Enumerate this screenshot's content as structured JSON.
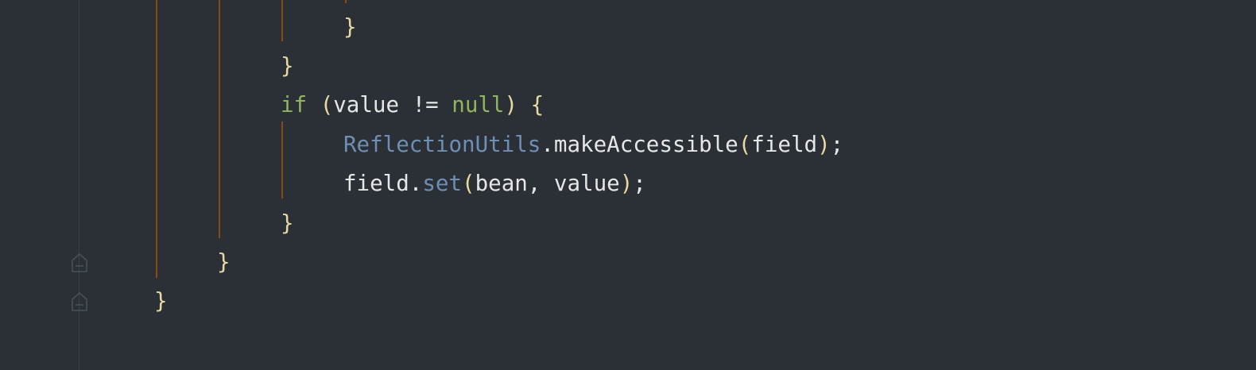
{
  "editor": {
    "colors": {
      "background": "#2a3035",
      "keyword": "#8fb55e",
      "bracket": "#e8d9a0",
      "type": "#6e8fb3",
      "text": "#e6e6e6",
      "indent_guide": "#8a4a18"
    },
    "gutter": {
      "icons": [
        "fold-end-icon",
        "fold-end-icon"
      ]
    },
    "lines": [
      {
        "name": "code-line-close-brace-1",
        "tokens": [
          {
            "text": "}",
            "kind": "brace"
          }
        ]
      },
      {
        "name": "code-line-close-brace-2",
        "tokens": [
          {
            "text": "}",
            "kind": "brace"
          }
        ]
      },
      {
        "name": "code-line-if",
        "tokens": [
          {
            "text": "if",
            "kind": "kw"
          },
          {
            "text": " ",
            "kind": "punct"
          },
          {
            "text": "(",
            "kind": "paren"
          },
          {
            "text": "value != ",
            "kind": "ident"
          },
          {
            "text": "null",
            "kind": "kw"
          },
          {
            "text": ")",
            "kind": "paren"
          },
          {
            "text": " ",
            "kind": "punct"
          },
          {
            "text": "{",
            "kind": "brace"
          }
        ]
      },
      {
        "name": "code-line-make-accessible",
        "tokens": [
          {
            "text": "ReflectionUtils",
            "kind": "cls"
          },
          {
            "text": ".makeAccessible",
            "kind": "ident"
          },
          {
            "text": "(",
            "kind": "paren"
          },
          {
            "text": "field",
            "kind": "ident"
          },
          {
            "text": ")",
            "kind": "paren"
          },
          {
            "text": ";",
            "kind": "punct"
          }
        ]
      },
      {
        "name": "code-line-field-set",
        "tokens": [
          {
            "text": "field.",
            "kind": "ident"
          },
          {
            "text": "set",
            "kind": "method"
          },
          {
            "text": "(",
            "kind": "paren"
          },
          {
            "text": "bean, value",
            "kind": "ident"
          },
          {
            "text": ")",
            "kind": "paren"
          },
          {
            "text": ";",
            "kind": "punct"
          }
        ]
      },
      {
        "name": "code-line-close-brace-3",
        "tokens": [
          {
            "text": "}",
            "kind": "brace"
          }
        ]
      },
      {
        "name": "code-line-close-brace-4",
        "tokens": [
          {
            "text": "}",
            "kind": "brace"
          }
        ]
      },
      {
        "name": "code-line-close-brace-5",
        "tokens": [
          {
            "text": "}",
            "kind": "brace"
          }
        ]
      }
    ]
  }
}
